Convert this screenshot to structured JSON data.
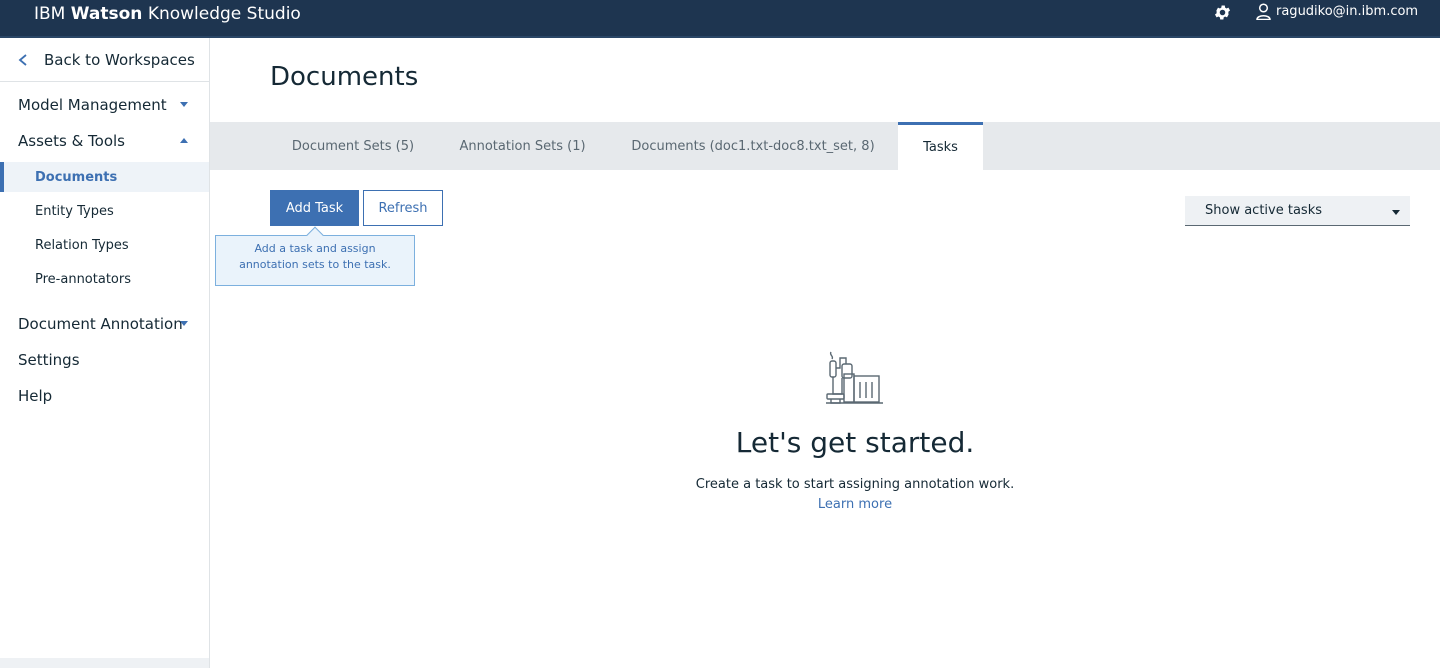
{
  "header": {
    "brand_prefix": "IBM",
    "brand_bold": "Watson",
    "brand_suffix": "Knowledge Studio",
    "settings_icon": "gear-icon",
    "user_icon": "user-icon",
    "user_email": "ragudiko@in.ibm.com"
  },
  "sidebar": {
    "back_label": "Back to Workspaces",
    "back_icon": "chevron-left-icon",
    "sections": [
      {
        "label": "Model Management",
        "expanded": false
      },
      {
        "label": "Assets & Tools",
        "expanded": true
      },
      {
        "label": "Document Annotation",
        "expanded": false
      },
      {
        "label": "Settings"
      },
      {
        "label": "Help"
      }
    ],
    "assets_items": [
      {
        "label": "Documents",
        "active": true
      },
      {
        "label": "Entity Types"
      },
      {
        "label": "Relation Types"
      },
      {
        "label": "Pre-annotators"
      }
    ]
  },
  "main": {
    "title": "Documents",
    "tabs": [
      {
        "label": "Document Sets (5)"
      },
      {
        "label": "Annotation Sets (1)"
      },
      {
        "label": "Documents (doc1.txt-doc8.txt_set, 8)"
      },
      {
        "label": "Tasks",
        "active": true
      }
    ],
    "add_task_label": "Add Task",
    "refresh_label": "Refresh",
    "tooltip_text": "Add a task and assign annotation sets to the task.",
    "filter_selected": "Show active tasks",
    "empty_state": {
      "icon": "factory-illustration-icon",
      "title": "Let's get started.",
      "description": "Create a task to start assigning annotation work.",
      "link_label": "Learn more"
    }
  },
  "colors": {
    "header_bg": "#1e3550",
    "accent": "#3d70b2",
    "tabbar_bg": "#e6e9ec",
    "tooltip_bg": "#eaf3fb"
  }
}
